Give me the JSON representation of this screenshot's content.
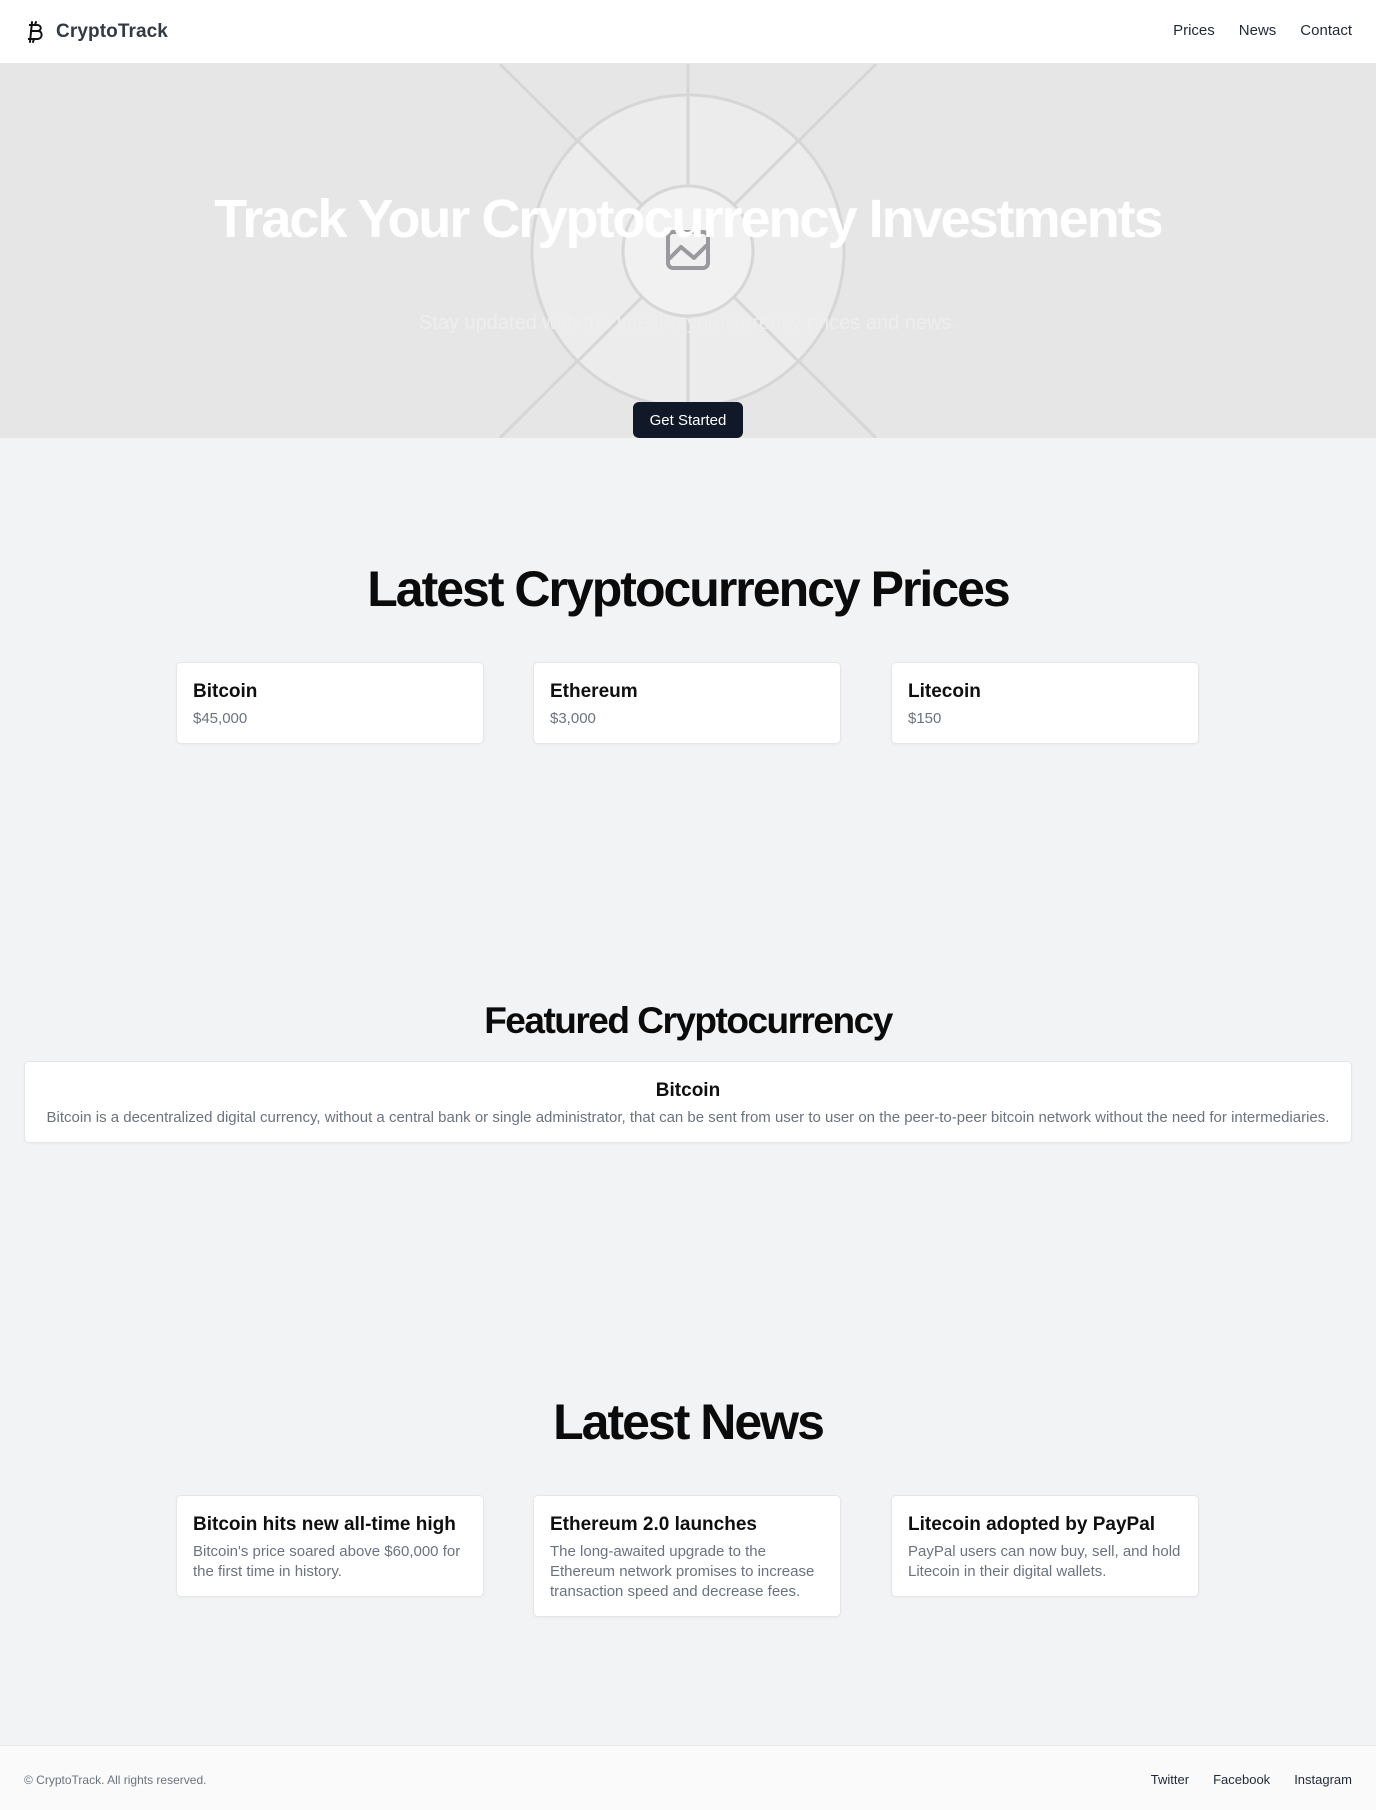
{
  "header": {
    "brand_icon": "bitcoin-icon",
    "brand_name": "CryptoTrack",
    "nav": [
      "Prices",
      "News",
      "Contact"
    ]
  },
  "hero": {
    "image_icon": "image-placeholder-icon",
    "title": "Track Your Cryptocurrency Investments",
    "subtitle": "Stay updated with the latest cryptocurrency prices and news.",
    "cta": "Get Started"
  },
  "prices": {
    "title": "Latest Cryptocurrency Prices",
    "items": [
      {
        "name": "Bitcoin",
        "price": "$45,000"
      },
      {
        "name": "Ethereum",
        "price": "$3,000"
      },
      {
        "name": "Litecoin",
        "price": "$150"
      }
    ]
  },
  "featured": {
    "title": "Featured Cryptocurrency",
    "name": "Bitcoin",
    "description": "Bitcoin is a decentralized digital currency, without a central bank or single administrator, that can be sent from user to user on the peer-to-peer bitcoin network without the need for intermediaries."
  },
  "news": {
    "title": "Latest News",
    "items": [
      {
        "headline": "Bitcoin hits new all-time high",
        "summary": "Bitcoin's price soared above $60,000 for the first time in history."
      },
      {
        "headline": "Ethereum 2.0 launches",
        "summary": "The long-awaited upgrade to the Ethereum network promises to increase transaction speed and decrease fees."
      },
      {
        "headline": "Litecoin adopted by PayPal",
        "summary": "PayPal users can now buy, sell, and hold Litecoin in their digital wallets."
      }
    ]
  },
  "footer": {
    "copyright": "© CryptoTrack. All rights reserved.",
    "links": [
      "Twitter",
      "Facebook",
      "Instagram"
    ]
  },
  "colors": {
    "button_bg": "#111827",
    "page_bg": "#f2f3f5",
    "hero_bg": "#e6e6e7"
  }
}
